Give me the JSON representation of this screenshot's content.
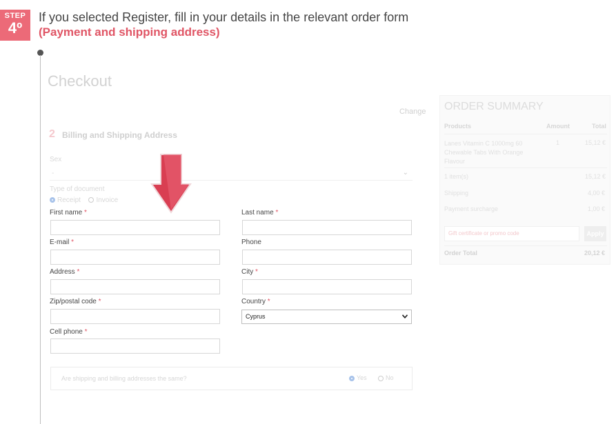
{
  "step": {
    "label": "STEP",
    "number": "4º"
  },
  "headline": "If you selected Register, fill in your details in the relevant order form",
  "headline_highlight": "(Payment and shipping address)",
  "checkout": {
    "title": "Checkout",
    "change_link": "Change",
    "section_number": "2",
    "section_title": "Billing and Shipping Address",
    "sex_label": "Sex",
    "sex_value": "-",
    "doc_type_label": "Type of document",
    "doc_options": [
      "Receipt",
      "Invoice"
    ],
    "doc_selected": "Receipt"
  },
  "form": {
    "first_name": "First name",
    "last_name": "Last name",
    "email": "E-mail",
    "phone": "Phone",
    "address": "Address",
    "city": "City",
    "zip": "Zip/postal code",
    "country": "Country",
    "country_value": "Cyprus",
    "cell_phone": "Cell phone",
    "required_mark": "*"
  },
  "same_address": {
    "question": "Are shipping and billing addresses the same?",
    "yes": "Yes",
    "no": "No",
    "selected": "Yes"
  },
  "order_summary": {
    "title": "ORDER SUMMARY",
    "col_product": "Products",
    "col_amount": "Amount",
    "col_total": "Total",
    "product_name_1": "Lanes Vitamin C 1000mg 60",
    "product_name_2": "Chewable Tabs With Orange",
    "product_name_3": "Flavour",
    "product_amount": "1",
    "product_total": "15,12 €",
    "items_label": "1 item(s)",
    "items_total": "15,12 €",
    "shipping_label": "Shipping",
    "shipping_total": "4,00 €",
    "surcharge_label": "Payment surcharge",
    "surcharge_total": "1,00 €",
    "coupon_placeholder": "Gift certificate or promo code",
    "apply_label": "Apply",
    "order_total_label": "Order Total",
    "order_total": "20,12 €"
  },
  "colors": {
    "accent": "#ec6a78",
    "highlight": "#e05565"
  },
  "icons": {
    "arrow": "down-arrow-icon",
    "select": "chevron-down-icon"
  }
}
